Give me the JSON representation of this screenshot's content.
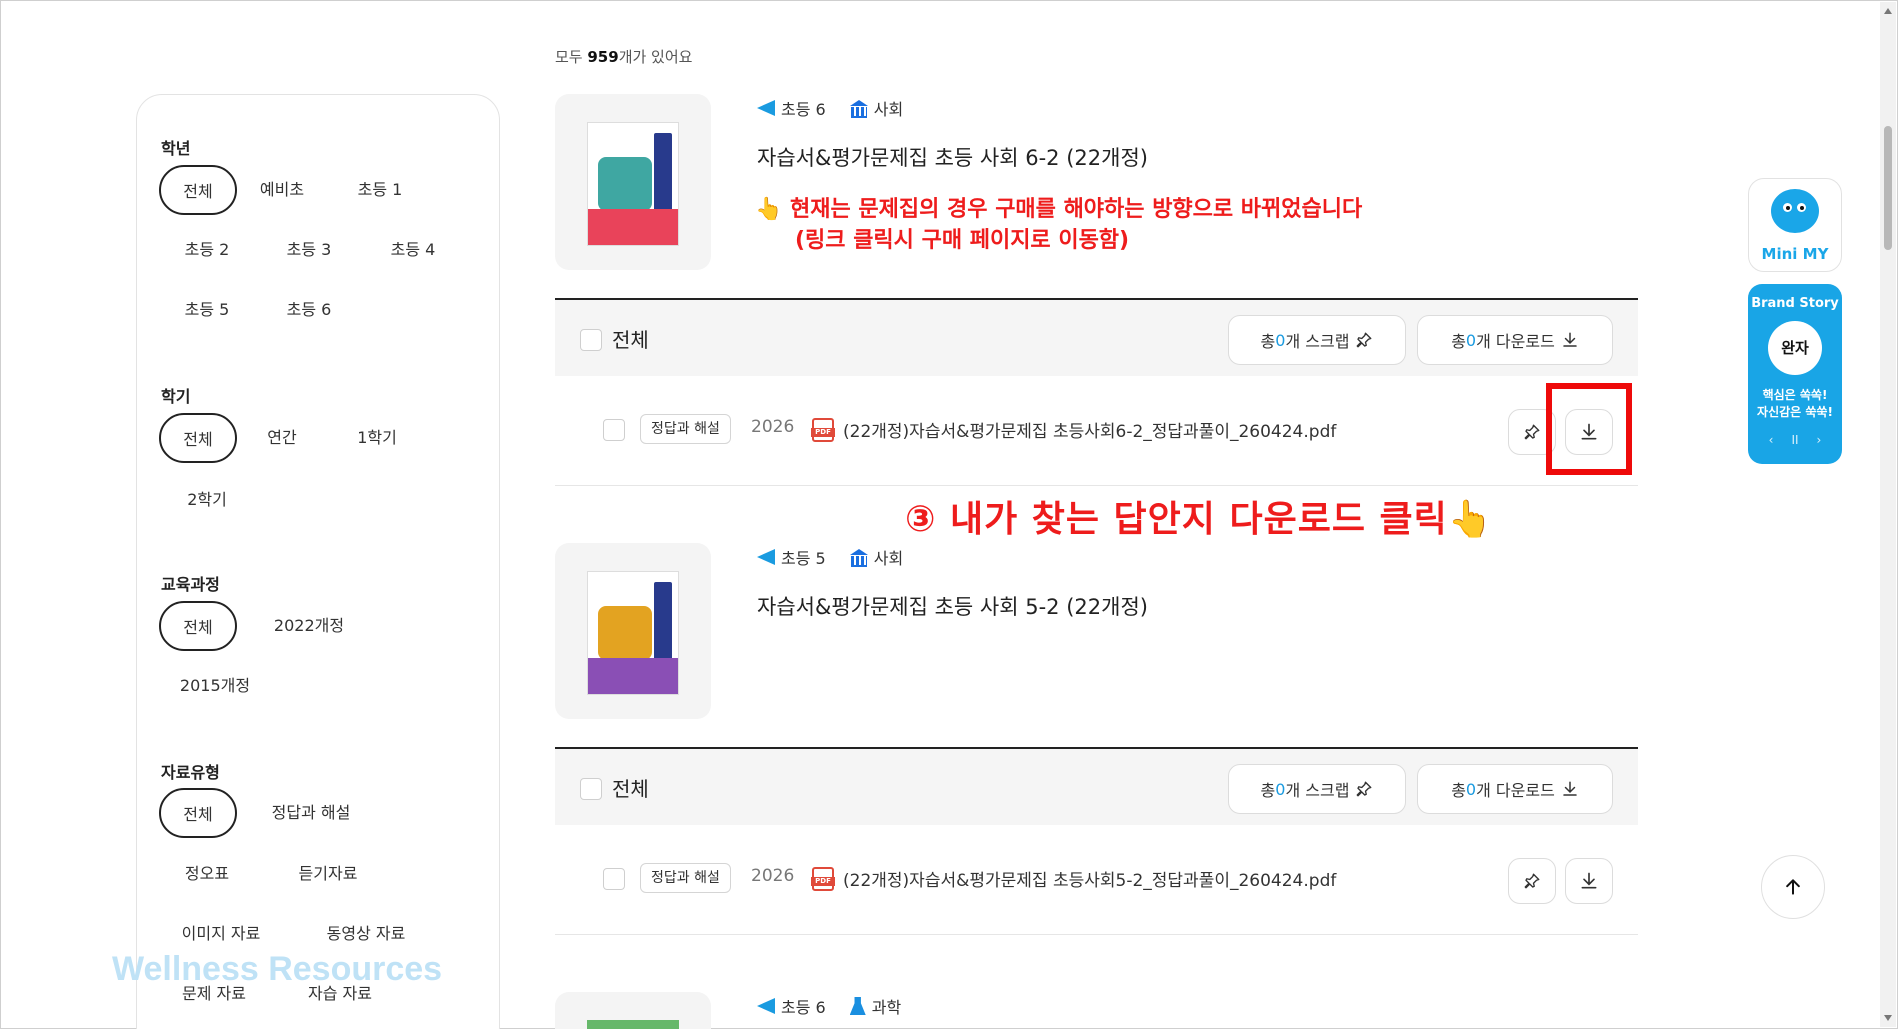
{
  "filters": {
    "grade": {
      "title": "학년",
      "options": [
        "전체",
        "예비초",
        "초등 1",
        "초등 2",
        "초등 3",
        "초등 4",
        "초등 5",
        "초등 6"
      ]
    },
    "semester": {
      "title": "학기",
      "options": [
        "전체",
        "연간",
        "1학기",
        "2학기"
      ]
    },
    "curriculum": {
      "title": "교육과정",
      "options": [
        "전체",
        "2022개정",
        "2015개정"
      ]
    },
    "material_type": {
      "title": "자료유형",
      "options": [
        "전체",
        "정답과 해설",
        "정오표",
        "듣기자료",
        "이미지 자료",
        "동영상 자료",
        "문제 자료",
        "자습 자료"
      ]
    }
  },
  "results": {
    "prefix": "모두 ",
    "count": "959",
    "suffix": "개가 있어요"
  },
  "books": [
    {
      "grade": "초등 6",
      "subject": "사회",
      "title": "자습서&평가문제집 초등 사회 6-2 (22개정)",
      "bar": {
        "all_label": "전체",
        "scrap_prefix": "총 ",
        "scrap_num": "0",
        "scrap_suffix": "개 스크랩",
        "download_prefix": "총 ",
        "download_num": "0",
        "download_suffix": "개 다운로드"
      },
      "file": {
        "badge": "정답과 해설",
        "year": "2026",
        "name": "(22개정)자습서&평가문제집 초등사회6-2_정답과풀이_260424.pdf"
      }
    },
    {
      "grade": "초등 5",
      "subject": "사회",
      "title": "자습서&평가문제집 초등 사회 5-2 (22개정)",
      "bar": {
        "all_label": "전체",
        "scrap_prefix": "총 ",
        "scrap_num": "0",
        "scrap_suffix": "개 스크랩",
        "download_prefix": "총 ",
        "download_num": "0",
        "download_suffix": "개 다운로드"
      },
      "file": {
        "badge": "정답과 해설",
        "year": "2026",
        "name": "(22개정)자습서&평가문제집 초등사회5-2_정답과풀이_260424.pdf"
      }
    },
    {
      "grade": "초등 6",
      "subject": "과학"
    }
  ],
  "annotations": {
    "notice_line1": "👆 현재는 문제집의 경우 구매를 해야하는 방향으로 바뀌었습니다",
    "notice_line2": "(링크 클릭시 구매 페이지로 이동함)",
    "step": "③ 내가 찾는 답안지 다운로드 클릭👆"
  },
  "widgets": {
    "mini_my": "Mini MY",
    "brand_story": "Brand Story",
    "brand_logo": "완자",
    "brand_line1": "핵심은 쏙쏙!",
    "brand_line2": "자신감은 쑥쑥!",
    "brand_pause": "II"
  },
  "watermark": "Wellness Resources",
  "colors": {
    "accent": "#1a9be0",
    "annotation": "#ee1c1c",
    "brand": "#19a5e6"
  }
}
